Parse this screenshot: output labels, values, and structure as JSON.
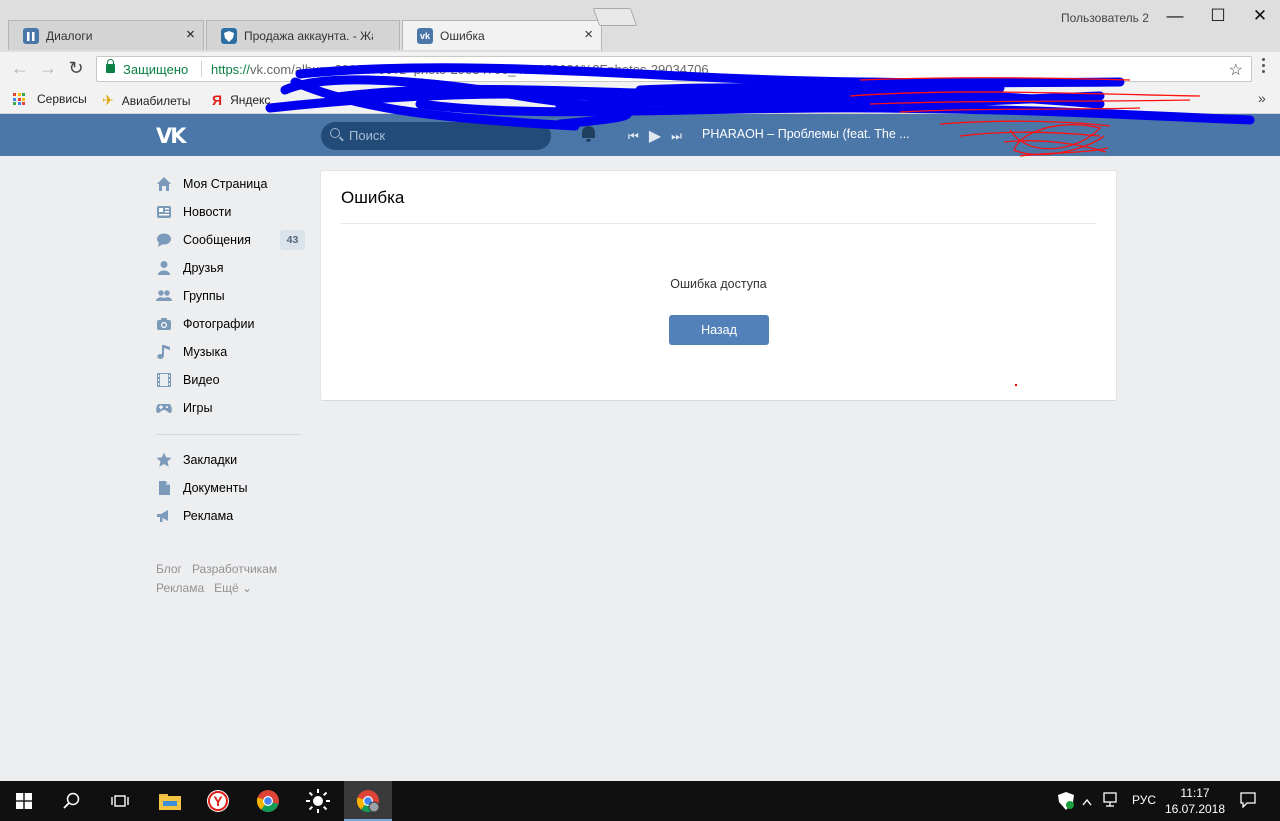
{
  "browser": {
    "tabs": [
      {
        "title": "Диалоги",
        "favicon_color": "#4a76a8",
        "favicon_glyph": "pause"
      },
      {
        "title": "Продажа аккаунта. - Жа",
        "favicon_color": "#2d6ea3",
        "favicon_glyph": "shield"
      },
      {
        "title": "Ошибка",
        "favicon_color": "#4a76a8",
        "favicon_glyph": "vk"
      }
    ],
    "close_glyph": "×",
    "profile": "Пользователь 2",
    "window_controls": {
      "minimize": "—",
      "maximize": "☐",
      "close": "✕"
    },
    "nav": {
      "back": "←",
      "forward": "→",
      "reload": "↻"
    },
    "secure_label": "Защищено",
    "url_scheme": "https://",
    "url_rest": "vk.com/album-29034706?z=photo-29034706_456250621%2Fphotos-29034706",
    "bookmark_star": "☆",
    "bookmarks": [
      {
        "label": "Сервисы",
        "icon": "apps-icon"
      },
      {
        "label": "Авиабилеты",
        "icon": "plane-icon"
      },
      {
        "label": "Яндекс",
        "icon": "yandex-icon"
      }
    ],
    "bookmarks_more": "»"
  },
  "vk": {
    "logo": "VK",
    "search_placeholder": "Поиск",
    "player": {
      "prev": "⏮",
      "play": "▶",
      "next": "⏭",
      "track": "PHARAOH – Проблемы (feat. The ..."
    },
    "nav": [
      {
        "label": "Моя Страница",
        "icon": "home-icon"
      },
      {
        "label": "Новости",
        "icon": "news-icon"
      },
      {
        "label": "Сообщения",
        "icon": "messages-icon",
        "count": "43"
      },
      {
        "label": "Друзья",
        "icon": "friends-icon"
      },
      {
        "label": "Группы",
        "icon": "groups-icon"
      },
      {
        "label": "Фотографии",
        "icon": "camera-icon"
      },
      {
        "label": "Музыка",
        "icon": "music-icon"
      },
      {
        "label": "Видео",
        "icon": "video-icon"
      },
      {
        "label": "Игры",
        "icon": "gamepad-icon"
      }
    ],
    "nav2": [
      {
        "label": "Закладки",
        "icon": "star-icon"
      },
      {
        "label": "Документы",
        "icon": "document-icon"
      },
      {
        "label": "Реклама",
        "icon": "megaphone-icon"
      }
    ],
    "footer": {
      "row1": [
        "Блог",
        "Разработчикам"
      ],
      "row2": [
        "Реклама",
        "Ещё ⌄"
      ]
    },
    "card": {
      "title": "Ошибка",
      "message": "Ошибка доступа",
      "button": "Назад"
    }
  },
  "taskbar": {
    "lang": "РУС",
    "time": "11:17",
    "date": "16.07.2018"
  },
  "colors": {
    "vk_header": "#4a76a8",
    "vk_button": "#5181b8",
    "page_bg": "#edeef0",
    "secure_green": "#0b8043"
  }
}
